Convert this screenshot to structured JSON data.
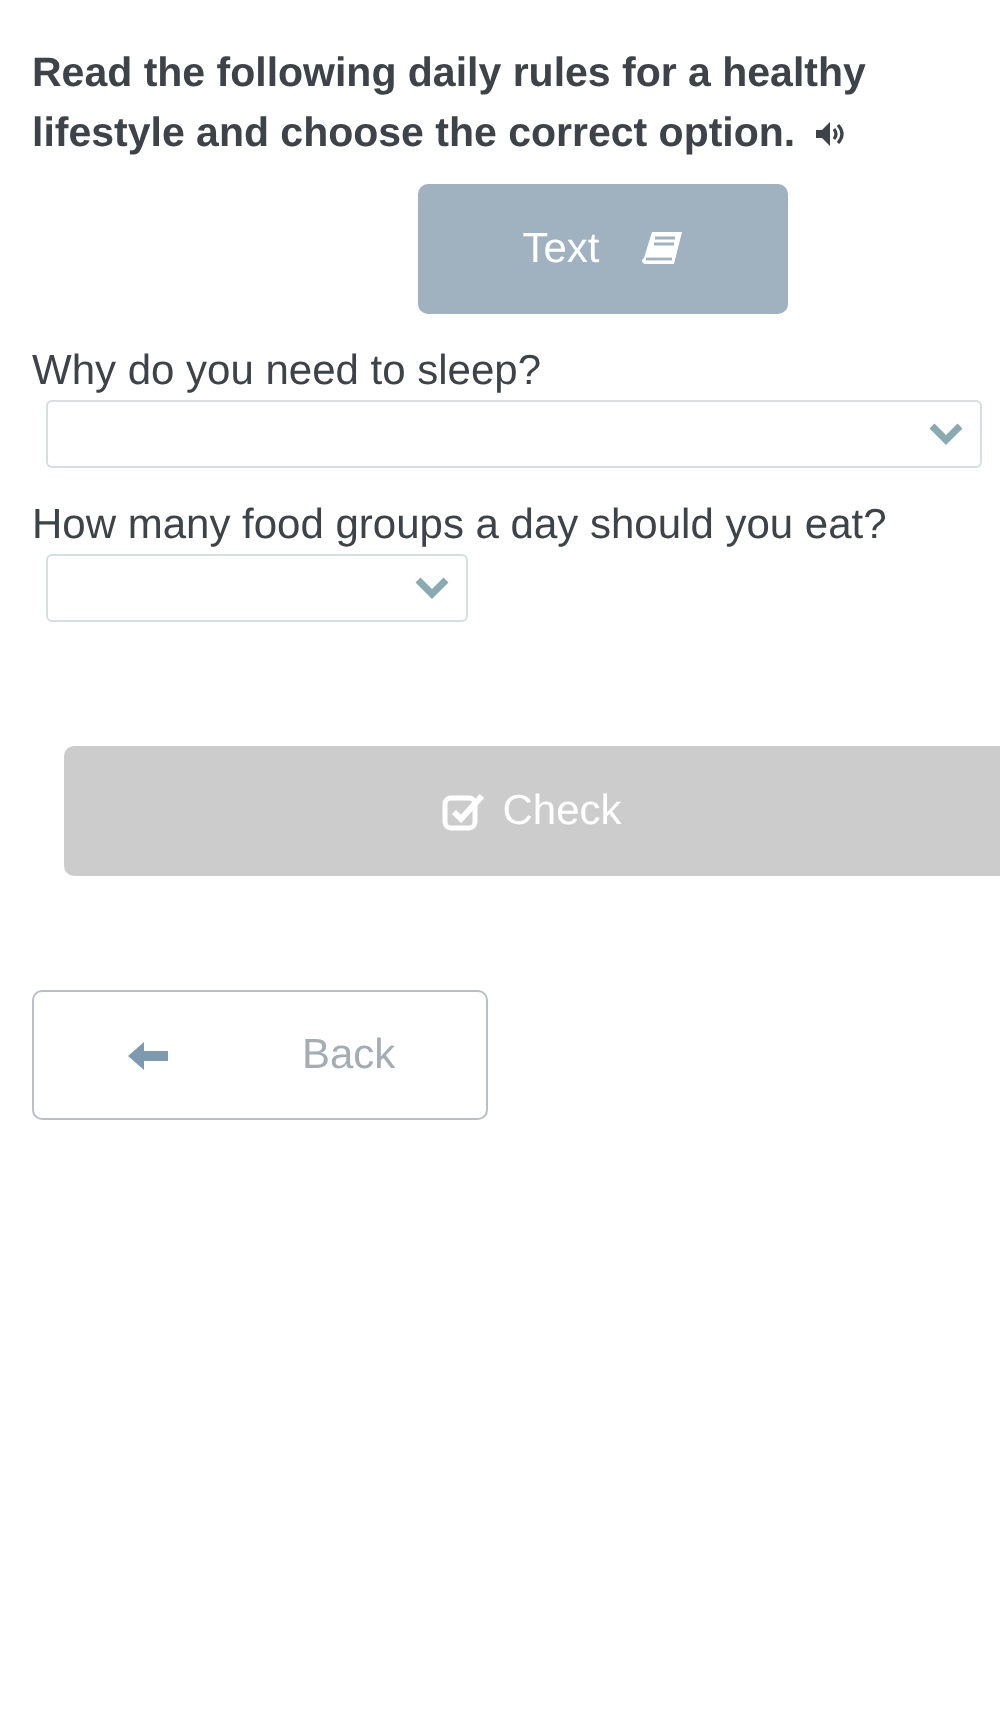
{
  "instruction": {
    "text": "Read the following daily rules for a healthy lifestyle and choose the correct option."
  },
  "text_button": {
    "label": "Text"
  },
  "questions": [
    {
      "prompt": "Why do you need to sleep?",
      "kind": "long"
    },
    {
      "prompt": "How many food groups a day should you eat?",
      "kind": "short"
    }
  ],
  "check_button": {
    "label": "Check",
    "disabled": true
  },
  "back_button": {
    "label": "Back"
  }
}
